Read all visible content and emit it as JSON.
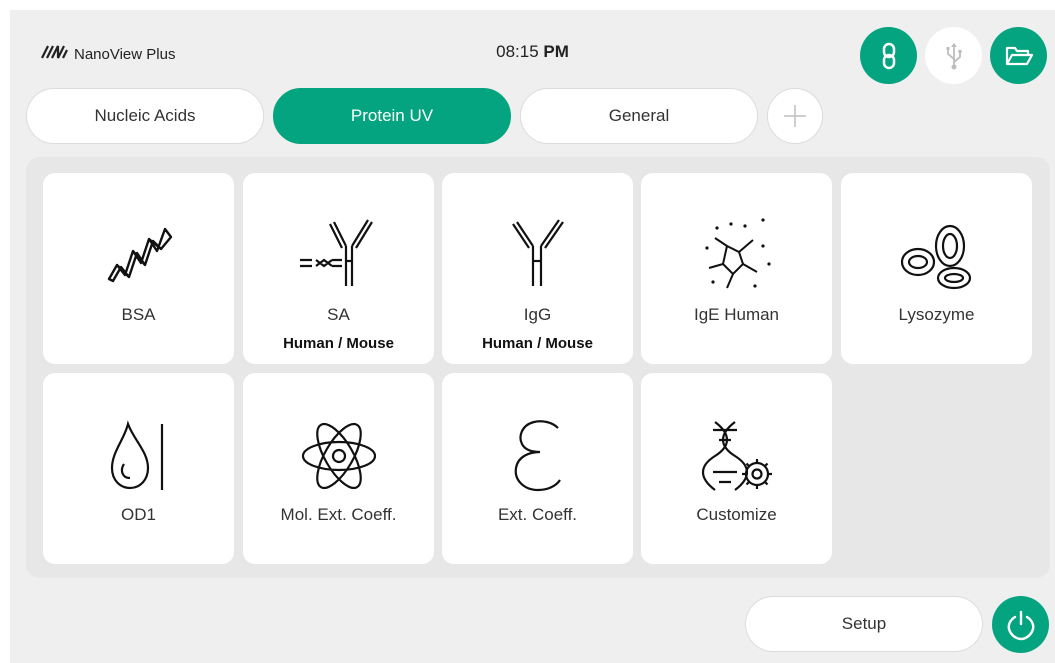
{
  "header": {
    "logo_mark": "NV",
    "brand_name": "NanoView Plus",
    "time": "08:15",
    "ampm": "PM",
    "icons": [
      "link-icon",
      "usb-icon",
      "folder-icon"
    ]
  },
  "tabs": [
    {
      "label": "Nucleic Acids",
      "active": false
    },
    {
      "label": "Protein UV",
      "active": true
    },
    {
      "label": "General",
      "active": false
    }
  ],
  "apps": [
    {
      "label": "BSA",
      "sub": "",
      "icon": "bsa-helix-icon"
    },
    {
      "label": "SA",
      "sub": "Human / Mouse",
      "icon": "sa-antibody-icon"
    },
    {
      "label": "IgG",
      "sub": "Human / Mouse",
      "icon": "igg-antibody-icon"
    },
    {
      "label": "IgE Human",
      "sub": "",
      "icon": "ige-molecule-icon"
    },
    {
      "label": "Lysozyme",
      "sub": "",
      "icon": "lysozyme-chain-icon"
    },
    {
      "label": "OD1",
      "sub": "",
      "icon": "drop-icon"
    },
    {
      "label": "Mol. Ext. Coeff.",
      "sub": "",
      "icon": "atom-icon"
    },
    {
      "label": "Ext. Coeff.",
      "sub": "",
      "icon": "epsilon-icon"
    },
    {
      "label": "Customize",
      "sub": "",
      "icon": "dna-gear-icon"
    }
  ],
  "footer": {
    "setup_label": "Setup"
  },
  "colors": {
    "accent": "#03a47f",
    "background": "#efefef",
    "panel": "#e7e7e7",
    "tile": "#ffffff"
  }
}
